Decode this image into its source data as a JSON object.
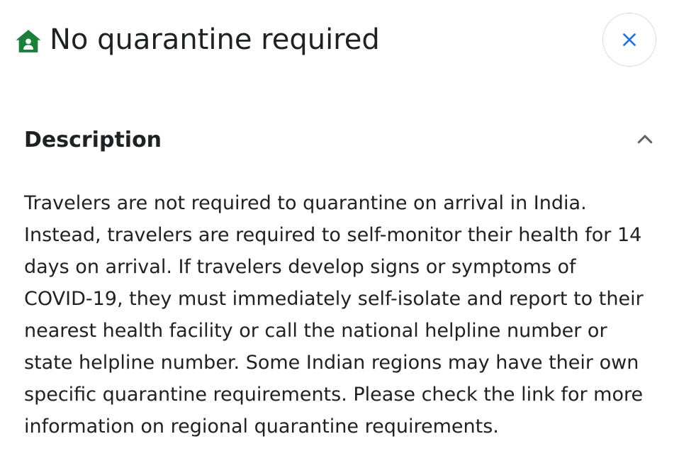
{
  "header": {
    "icon": "home-person-icon",
    "title": "No quarantine required",
    "close_icon": "close-icon"
  },
  "section": {
    "title": "Description",
    "toggle_icon": "chevron-up-icon",
    "body": "Travelers are not required to quarantine on arrival in India. Instead, travelers are required to self-monitor their health for 14 days on arrival. If travelers develop signs or symptoms of COVID-19, they must immediately self-isolate and report to their nearest health facility or call the national helpline number or state helpline number. Some Indian regions may have their own specific quarantine requirements. Please check the link for more information on regional quarantine requirements."
  },
  "colors": {
    "icon_green": "#188038",
    "close_blue": "#1a73e8",
    "text": "#202124",
    "border": "#dadce0"
  }
}
